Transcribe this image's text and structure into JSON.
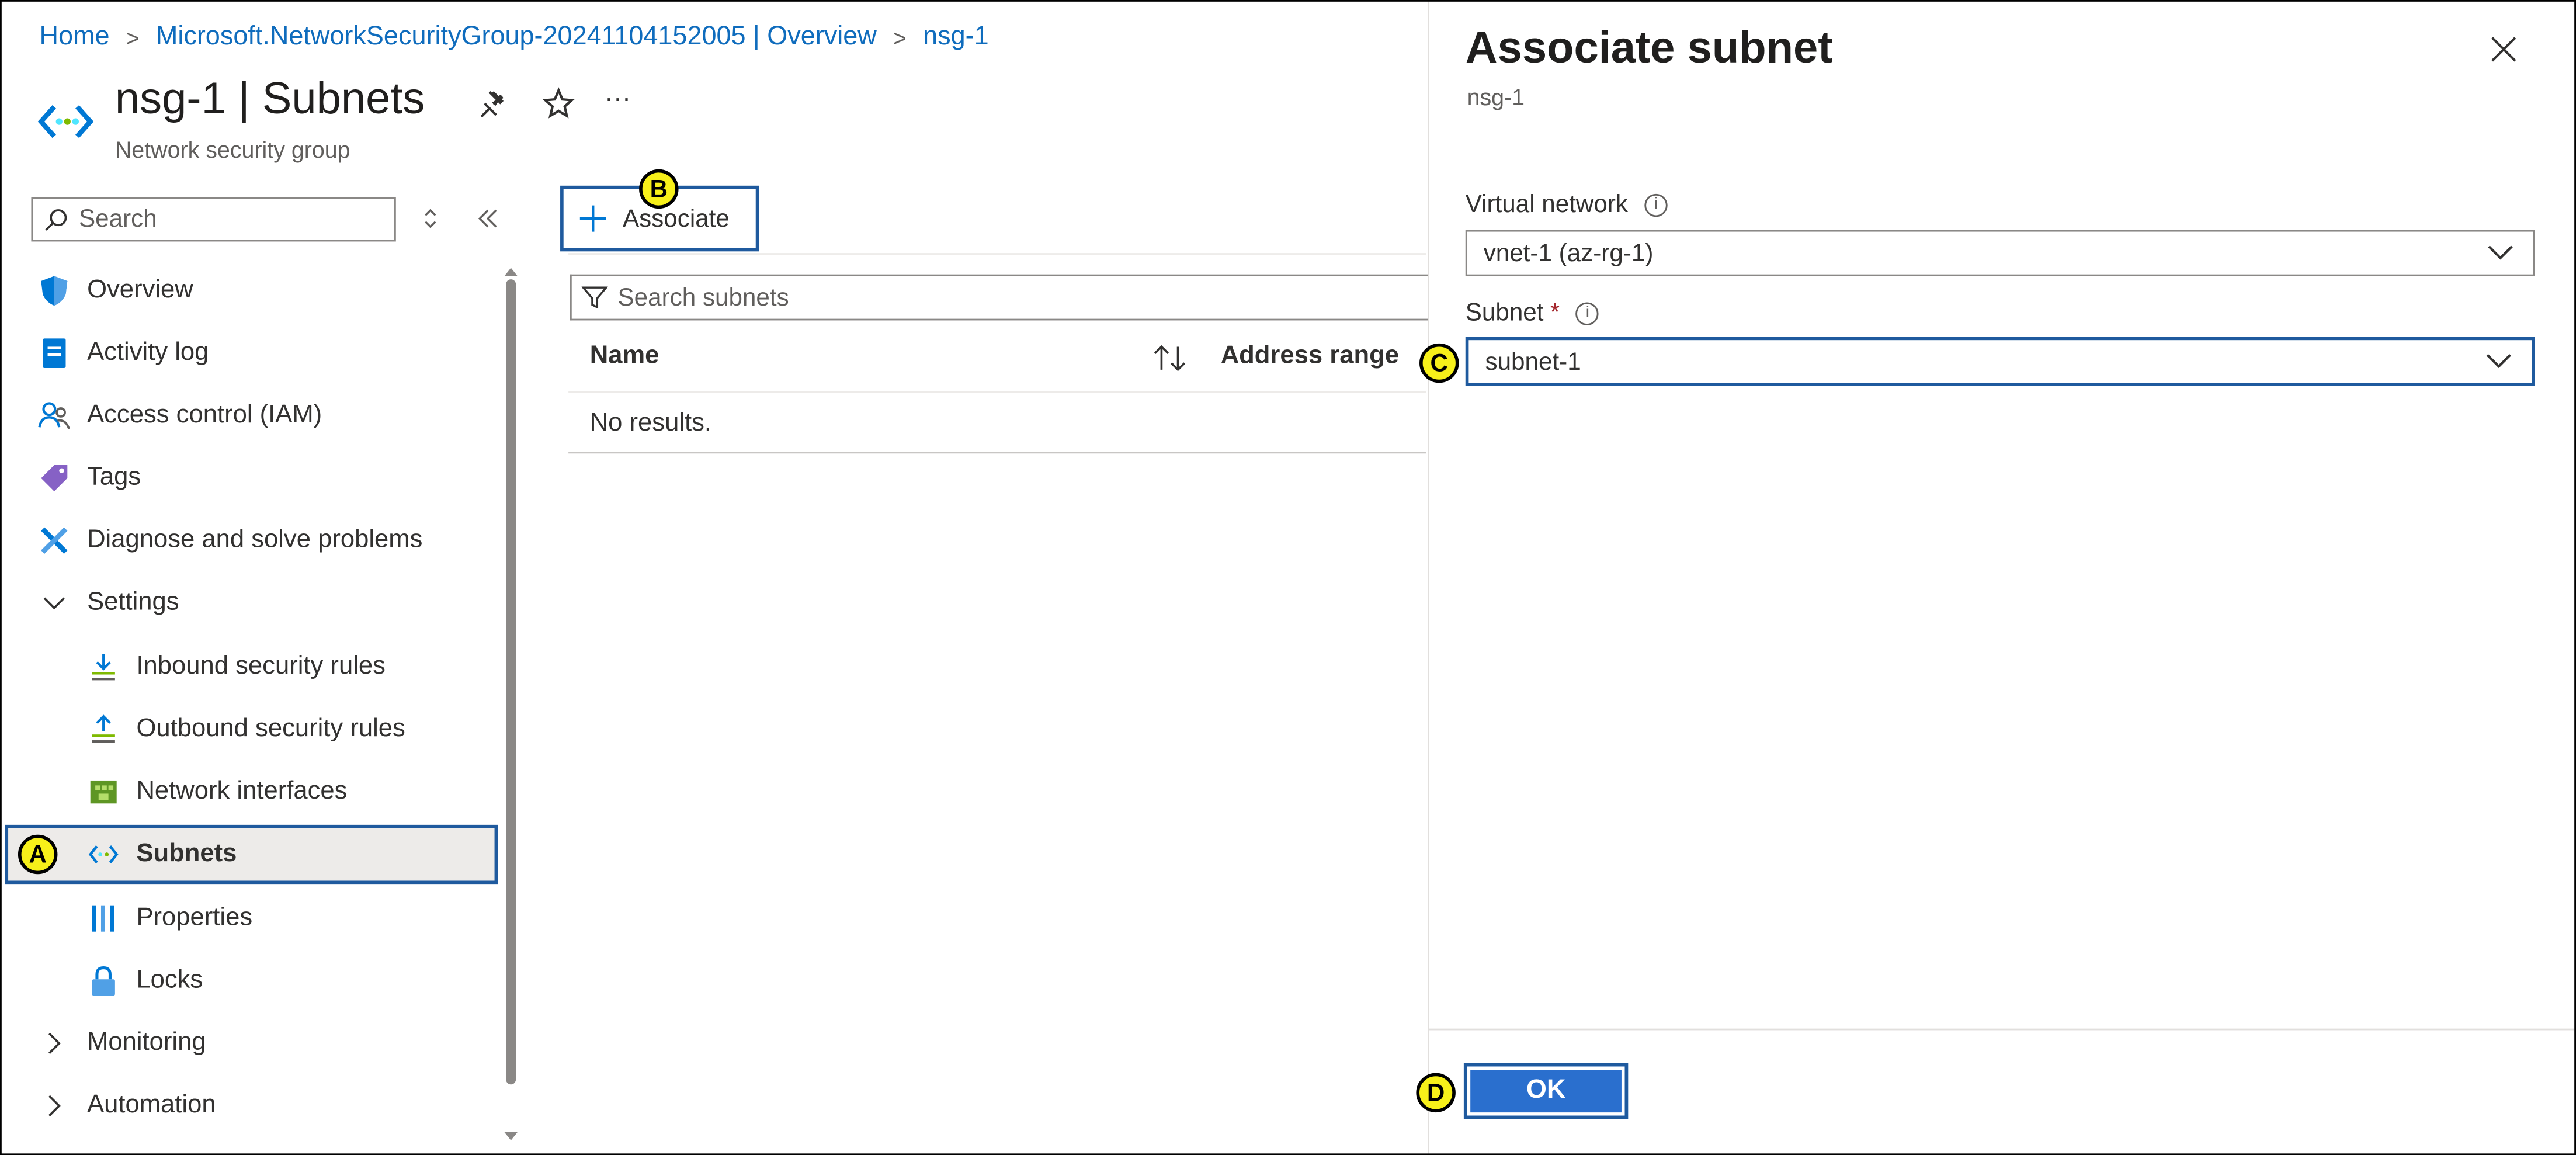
{
  "breadcrumb": {
    "home": "Home",
    "resource": "Microsoft.NetworkSecurityGroup-20241104152005 | Overview",
    "current": "nsg-1"
  },
  "header": {
    "title": "nsg-1 | Subnets",
    "subtitle": "Network security group",
    "more": "···"
  },
  "sidebar": {
    "search_placeholder": "Search",
    "items": [
      {
        "label": "Overview",
        "icon": "shield-icon"
      },
      {
        "label": "Activity log",
        "icon": "activity-log-icon"
      },
      {
        "label": "Access control (IAM)",
        "icon": "people-icon"
      },
      {
        "label": "Tags",
        "icon": "tag-icon"
      },
      {
        "label": "Diagnose and solve problems",
        "icon": "wrench-icon"
      },
      {
        "label": "Settings",
        "icon": "chevron-down-icon"
      },
      {
        "label": "Inbound security rules",
        "icon": "inbound-rules-icon"
      },
      {
        "label": "Outbound security rules",
        "icon": "outbound-rules-icon"
      },
      {
        "label": "Network interfaces",
        "icon": "network-interface-icon"
      },
      {
        "label": "Subnets",
        "icon": "subnet-icon"
      },
      {
        "label": "Properties",
        "icon": "properties-icon"
      },
      {
        "label": "Locks",
        "icon": "lock-icon"
      },
      {
        "label": "Monitoring",
        "icon": "chevron-right-icon"
      },
      {
        "label": "Automation",
        "icon": "chevron-right-icon"
      }
    ]
  },
  "main": {
    "associate_label": "Associate",
    "filter_placeholder": "Search subnets",
    "columns": [
      "Name",
      "Address range"
    ],
    "empty": "No results."
  },
  "panel": {
    "title": "Associate subnet",
    "subtitle": "nsg-1",
    "vnet_label": "Virtual network",
    "vnet_value": "vnet-1 (az-rg-1)",
    "subnet_label": "Subnet",
    "required": "*",
    "subnet_value": "subnet-1",
    "ok_label": "OK"
  },
  "markers": {
    "a": "A",
    "b": "B",
    "c": "C",
    "d": "D"
  },
  "colors": {
    "accent": "#0f6cbd",
    "highlight": "#1f5a9e",
    "marker": "#f7f01a",
    "ok_button": "#2a6fce"
  }
}
